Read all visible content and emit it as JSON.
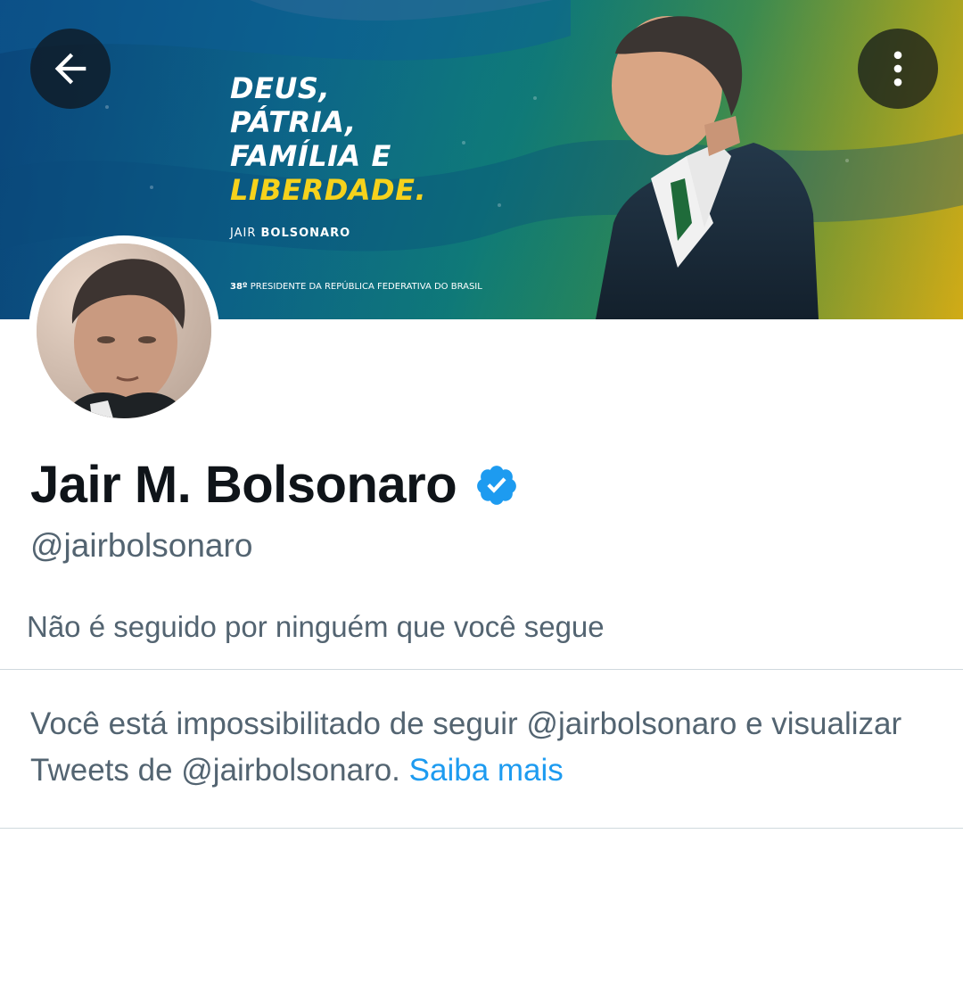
{
  "banner": {
    "headline": {
      "line1": "DEUS,",
      "line2": "PÁTRIA,",
      "line3": "FAMÍLIA E",
      "line4": "LIBERDADE."
    },
    "signature_first": "JAIR ",
    "signature_last": "BOLSONARO",
    "caption_ordinal": "38º",
    "caption_text": " PRESIDENTE DA REPÚBLICA FEDERATIVA DO BRASIL"
  },
  "toolbar": {
    "back_icon": "arrow-left-icon",
    "more_icon": "vertical-ellipsis-icon"
  },
  "profile": {
    "display_name": "Jair M. Bolsonaro",
    "verified": true,
    "handle": "@jairbolsonaro",
    "followers_note": "Não é seguido por ninguém que você segue"
  },
  "restriction": {
    "message": "Você está impossibilitado de seguir @jairbolsonaro e visualizar Tweets de @jairbolsonaro. ",
    "learn_more": "Saiba mais"
  },
  "colors": {
    "text_primary": "#0f1419",
    "text_secondary": "#536471",
    "link": "#1d9bf0",
    "verified_badge": "#1d9bf0",
    "divider": "#cfd9de",
    "headline_highlight": "#f6d21c"
  }
}
